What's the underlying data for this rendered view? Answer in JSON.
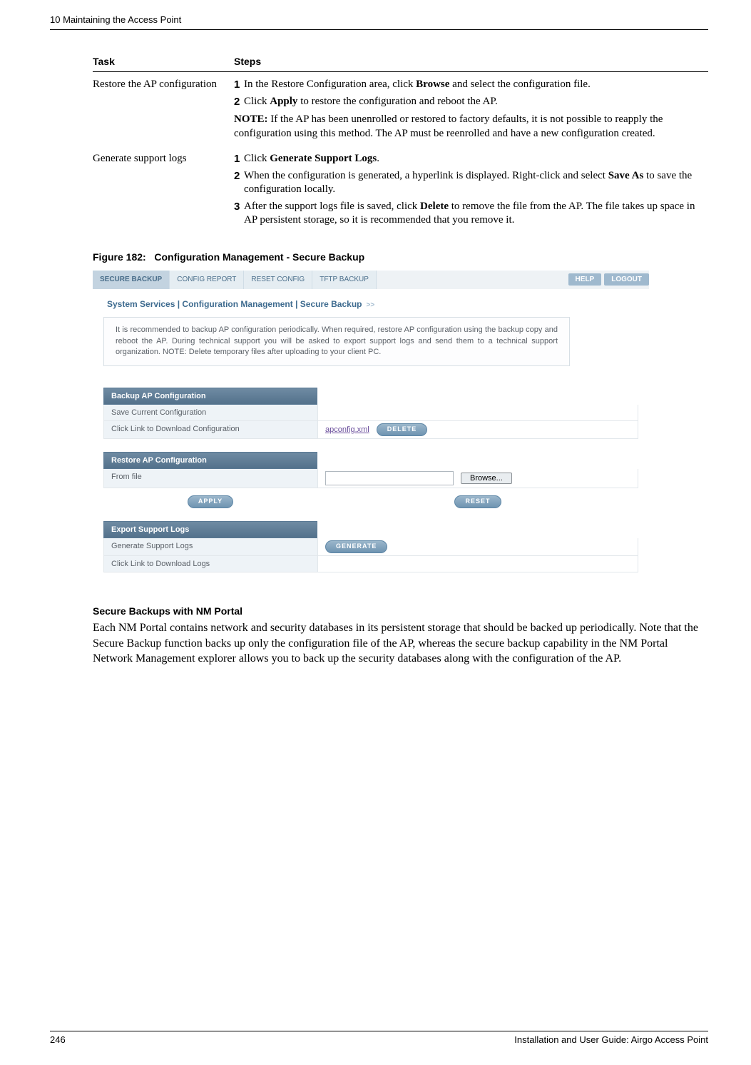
{
  "header": {
    "running": "10  Maintaining the Access Point"
  },
  "task_table": {
    "col1_header": "Task",
    "col2_header": "Steps",
    "rows": [
      {
        "task": "Restore the AP configuration",
        "steps": [
          {
            "num": "1",
            "pre": "In the Restore Configuration area, click ",
            "bold": "Browse",
            "post": " and select the configuration file."
          },
          {
            "num": "2",
            "pre": "Click ",
            "bold": "Apply",
            "post": " to restore the configuration and reboot the AP."
          }
        ],
        "note_label": "NOTE:",
        "note_text": " If the AP has been unenrolled or restored to factory defaults, it is not possible to reapply the configuration using this method. The AP must be reenrolled and have a new configuration created."
      },
      {
        "task": "Generate support logs",
        "steps": [
          {
            "num": "1",
            "pre": "Click ",
            "bold": "Generate Support Logs",
            "post": "."
          },
          {
            "num": "2",
            "pre": "When the configuration is generated, a hyperlink is displayed. Right-click and select ",
            "bold": "Save As",
            "post": " to save the configuration locally."
          },
          {
            "num": "3",
            "pre": "After the support logs file is saved, click ",
            "bold": "Delete",
            "post": " to remove the file from the AP. The file takes up space in AP persistent storage, so it is recommended that you remove it."
          }
        ]
      }
    ]
  },
  "figure": {
    "label": "Figure 182:",
    "caption": "Configuration Management - Secure Backup"
  },
  "shot": {
    "tabs": [
      "SECURE BACKUP",
      "CONFIG REPORT",
      "RESET CONFIG",
      "TFTP BACKUP"
    ],
    "active_tab_index": 0,
    "help": "HELP",
    "logout": "LOGOUT",
    "breadcrumb": "System Services | Configuration Management | Secure Backup",
    "bc_arrow": ">>",
    "info": "It is recommended to backup AP configuration periodically. When required, restore AP configuration using the backup copy and reboot the AP. During technical support you will be asked to export support logs and send them to a technical support organization. NOTE: Delete temporary files after uploading to your client PC.",
    "section_backup": "Backup AP Configuration",
    "row_save": "Save Current Configuration",
    "row_download": "Click Link to Download Configuration",
    "link_apconfig": "apconfig.xml",
    "btn_delete": "DELETE",
    "section_restore": "Restore AP Configuration",
    "row_fromfile": "From file",
    "from_file_value": "",
    "btn_browse": "Browse...",
    "btn_apply": "APPLY",
    "btn_reset": "RESET",
    "section_export": "Export Support Logs",
    "row_generate": "Generate Support Logs",
    "btn_generate": "GENERATE",
    "row_download_logs": "Click Link to Download Logs"
  },
  "nm_portal": {
    "heading": "Secure Backups with NM Portal",
    "body": "Each NM Portal contains network and security databases in its persistent storage that should be backed up periodically. Note that the Secure Backup function backs up only the configuration file of the AP, whereas the secure backup capability in the NM Portal Network Management explorer allows you to back up the security databases along with the configuration of the AP."
  },
  "footer": {
    "page": "246",
    "title": "Installation and User Guide: Airgo Access Point"
  }
}
